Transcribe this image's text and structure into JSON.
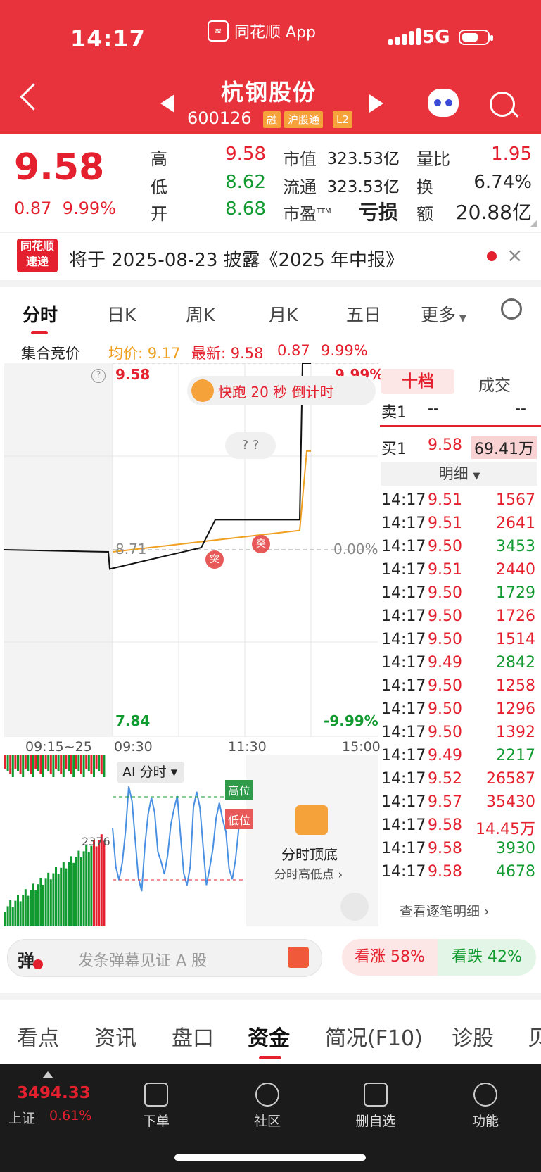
{
  "status_bar": {
    "time": "14:17",
    "app_name": "同花顺 App",
    "network": "5G"
  },
  "header": {
    "stock_name": "杭钢股份",
    "stock_code": "600126",
    "tags": [
      "融",
      "沪股通",
      "L2"
    ],
    "icons": [
      "back-icon",
      "prev-stock-icon",
      "next-stock-icon",
      "robot-icon",
      "search-icon"
    ]
  },
  "quote": {
    "price": "9.58",
    "change": "0.87",
    "change_pct": "9.99%",
    "fields": [
      {
        "label": "高",
        "value": "9.58",
        "color": "#e5202e"
      },
      {
        "label": "低",
        "value": "8.62",
        "color": "#119a2f"
      },
      {
        "label": "开",
        "value": "8.68",
        "color": "#119a2f"
      },
      {
        "label": "市值",
        "value": "323.53亿"
      },
      {
        "label": "流通",
        "value": "323.53亿"
      },
      {
        "label": "市盈",
        "sup": "TTM",
        "value": "亏损"
      },
      {
        "label": "量比",
        "value": "1.95",
        "color": "#e5202e"
      },
      {
        "label": "换",
        "value": "6.74%"
      },
      {
        "label": "额",
        "value": "20.88亿"
      }
    ]
  },
  "notice": {
    "logo_line1": "同花顺",
    "logo_line2": "速递",
    "text": "将于 2025-08-23 披露《2025 年中报》"
  },
  "chart_tabs": [
    "分时",
    "日K",
    "周K",
    "月K",
    "五日",
    "更多"
  ],
  "chart_info": {
    "auction_label": "集合竞价",
    "avg": "均价: 9.17",
    "latest": "最新: 9.58",
    "chg": "0.87",
    "pct": "9.99%"
  },
  "chart": {
    "top_price": "9.58",
    "top_pct": "9.99%",
    "mid_price": "8.71",
    "mid_pct": "0.00%",
    "bottom_price": "7.84",
    "bottom_pct": "-9.99%",
    "time_labels": [
      "09:15~25",
      "09:30",
      "11:30",
      "15:00"
    ],
    "banner": "快跑  20 秒  倒计时",
    "bubble": "? ?",
    "marker": "突",
    "ai_label": "AI 分时",
    "high_tag": "高位",
    "low_tag": "低位",
    "vol_label": "2376",
    "promo_title": "分时顶底",
    "promo_sub": "分时高低点"
  },
  "chart_data": {
    "type": "line",
    "x": [
      "09:30",
      "11:30",
      "15:00"
    ],
    "ylim": [
      7.84,
      9.58
    ],
    "series": [
      {
        "name": "均价",
        "values": [
          8.7,
          8.75,
          8.8,
          9.17
        ]
      },
      {
        "values": [
          8.71,
          8.7,
          8.62,
          8.72,
          8.85,
          8.85,
          9.58
        ]
      }
    ]
  },
  "order_book": {
    "tabs": [
      "十档",
      "成交"
    ],
    "sell1": {
      "label": "卖1",
      "price": "--",
      "vol": "--"
    },
    "buy1": {
      "label": "买1",
      "price": "9.58",
      "vol": "69.41万"
    },
    "detail_toggle": "明细",
    "rows": [
      {
        "t": "14:17",
        "p": "9.51",
        "v": "1567",
        "c": "#e5202e"
      },
      {
        "t": "14:17",
        "p": "9.51",
        "v": "2641",
        "c": "#e5202e"
      },
      {
        "t": "14:17",
        "p": "9.50",
        "v": "3453",
        "c": "#119a2f"
      },
      {
        "t": "14:17",
        "p": "9.51",
        "v": "2440",
        "c": "#e5202e"
      },
      {
        "t": "14:17",
        "p": "9.50",
        "v": "1729",
        "c": "#119a2f"
      },
      {
        "t": "14:17",
        "p": "9.50",
        "v": "1726",
        "c": "#e5202e"
      },
      {
        "t": "14:17",
        "p": "9.50",
        "v": "1514",
        "c": "#e5202e"
      },
      {
        "t": "14:17",
        "p": "9.49",
        "v": "2842",
        "c": "#119a2f"
      },
      {
        "t": "14:17",
        "p": "9.50",
        "v": "1258",
        "c": "#e5202e"
      },
      {
        "t": "14:17",
        "p": "9.50",
        "v": "1296",
        "c": "#e5202e"
      },
      {
        "t": "14:17",
        "p": "9.50",
        "v": "1392",
        "c": "#e5202e"
      },
      {
        "t": "14:17",
        "p": "9.49",
        "v": "2217",
        "c": "#119a2f"
      },
      {
        "t": "14:17",
        "p": "9.52",
        "v": "26587",
        "c": "#e5202e"
      },
      {
        "t": "14:17",
        "p": "9.57",
        "v": "35430",
        "c": "#e5202e"
      },
      {
        "t": "14:17",
        "p": "9.58",
        "v": "14.45万",
        "c": "#e5202e"
      },
      {
        "t": "14:17",
        "p": "9.58",
        "v": "3930",
        "c": "#119a2f"
      },
      {
        "t": "14:17",
        "p": "9.58",
        "v": "4678",
        "c": "#119a2f"
      }
    ],
    "view_all": "查看逐笔明细"
  },
  "danmu": {
    "label": "弹",
    "placeholder": "发条弹幕见证 A 股"
  },
  "vote": {
    "up": "看涨 58%",
    "down": "看跌 42%",
    "up_value": 58
  },
  "bottom_tabs": [
    "看点",
    "资讯",
    "盘口",
    "资金",
    "简况(F10)",
    "诊股",
    "贝"
  ],
  "nav": {
    "index_value": "3494.33",
    "index_name": "上证",
    "index_pct": "0.61%",
    "items": [
      "下单",
      "社区",
      "删自选",
      "功能"
    ]
  }
}
